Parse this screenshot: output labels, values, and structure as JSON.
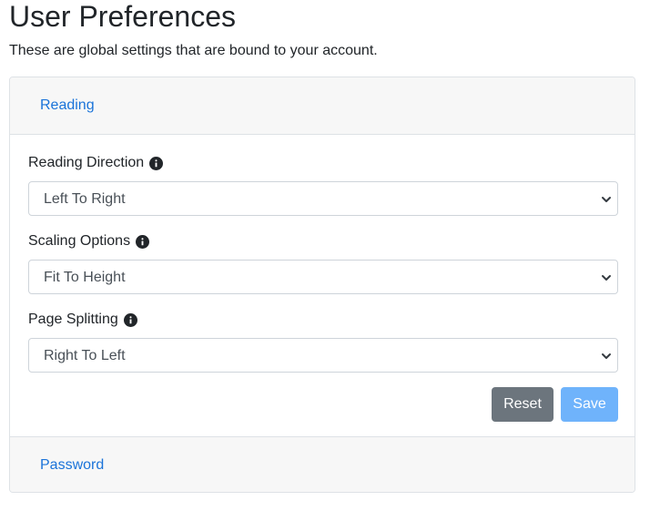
{
  "header": {
    "title": "User Preferences",
    "subtitle": "These are global settings that are bound to your account."
  },
  "accordion": {
    "sections": [
      {
        "label": "Reading"
      },
      {
        "label": "Password"
      }
    ]
  },
  "reading": {
    "fields": [
      {
        "label": "Reading Direction",
        "value": "Left To Right",
        "icon": "info-icon"
      },
      {
        "label": "Scaling Options",
        "value": "Fit To Height",
        "icon": "info-icon"
      },
      {
        "label": "Page Splitting",
        "value": "Right To Left",
        "icon": "info-icon"
      }
    ],
    "reset_label": "Reset",
    "save_label": "Save"
  },
  "colors": {
    "link": "#1a73d9",
    "reset_button": "#6c757d",
    "save_button": "#6fb3fb",
    "header_bg": "#f7f7f7"
  }
}
